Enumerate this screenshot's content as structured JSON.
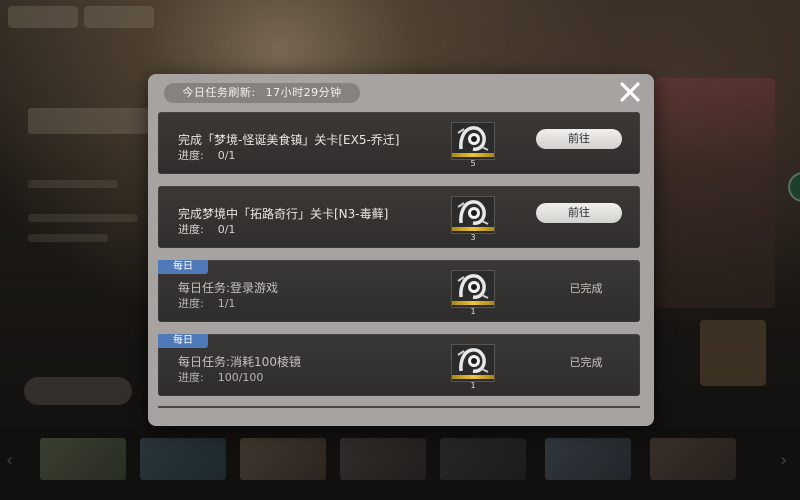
{
  "dialog": {
    "refresh_label": "今日任务刷新:",
    "refresh_time": "17小时29分钟"
  },
  "tasks": [
    {
      "title": "完成「梦境-怪诞美食镇」关卡[EX5-乔迁]",
      "progress_label": "进度:",
      "progress_value": "0/1",
      "reward_qty": "5",
      "action_label": "前往",
      "status": "pending",
      "tag": ""
    },
    {
      "title": "完成梦境中「拓路奇行」关卡[N3-毒藓]",
      "progress_label": "进度:",
      "progress_value": "0/1",
      "reward_qty": "3",
      "action_label": "前往",
      "status": "pending",
      "tag": ""
    },
    {
      "title": "每日任务:登录游戏",
      "progress_label": "进度:",
      "progress_value": "1/1",
      "reward_qty": "1",
      "action_label": "已完成",
      "status": "done",
      "tag": "每日"
    },
    {
      "title": "每日任务:消耗100棱镜",
      "progress_label": "进度:",
      "progress_value": "100/100",
      "reward_qty": "1",
      "action_label": "已完成",
      "status": "done",
      "tag": "每日"
    }
  ],
  "icons": {
    "close": "close-icon",
    "reward": "reward-item-icon"
  },
  "colors": {
    "daily_tag": "#4f79b8",
    "reward_bar": "#ecc53a",
    "dialog_bg": "#a6a3a0",
    "row_bg": "#353230"
  }
}
